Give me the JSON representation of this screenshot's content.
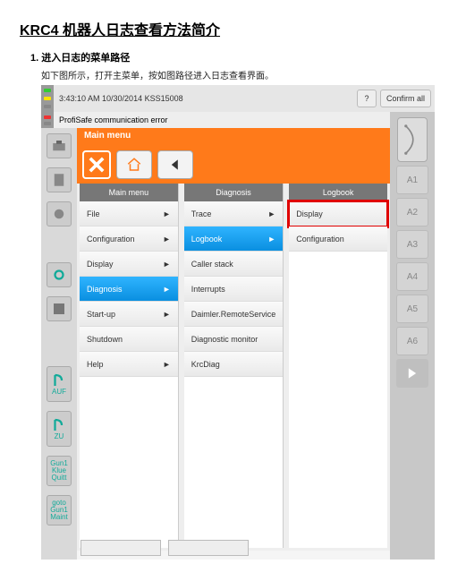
{
  "doc": {
    "title": "KRC4 机器人日志查看方法简介",
    "step_label": "1.  进入日志的菜单路径",
    "step_desc": "如下图所示，打开主菜单，按如图路径进入日志查看界面。"
  },
  "status": {
    "time_line": "3:43:10 AM 10/30/2014 KSS15008",
    "error": "ProfiSafe communication error",
    "help_label": "?",
    "confirm_label": "Confirm all"
  },
  "left_rail": {
    "auf": "AUF",
    "zu": "ZU",
    "gun1quit": "Gun1\nKlue\nQuitt",
    "goto": "goto\nGun1\nMaint"
  },
  "right_rail": {
    "axes": [
      "A1",
      "A2",
      "A3",
      "A4",
      "A5",
      "A6"
    ]
  },
  "menu": {
    "title": "Main menu",
    "col_headers": [
      "Main menu",
      "Diagnosis",
      "Logbook"
    ],
    "main": [
      {
        "label": "File",
        "arrow": true
      },
      {
        "label": "Configuration",
        "arrow": true
      },
      {
        "label": "Display",
        "arrow": true
      },
      {
        "label": "Diagnosis",
        "arrow": true,
        "selected": true
      },
      {
        "label": "Start-up",
        "arrow": true
      },
      {
        "label": "Shutdown",
        "arrow": false
      },
      {
        "label": "Help",
        "arrow": true
      }
    ],
    "diagnosis": [
      {
        "label": "Trace",
        "arrow": true
      },
      {
        "label": "Logbook",
        "arrow": true,
        "selected": true
      },
      {
        "label": "Caller stack",
        "arrow": false
      },
      {
        "label": "Interrupts",
        "arrow": false
      },
      {
        "label": "Daimler.RemoteService",
        "arrow": false
      },
      {
        "label": "Diagnostic monitor",
        "arrow": false
      },
      {
        "label": "KrcDiag",
        "arrow": false
      }
    ],
    "logbook": [
      {
        "label": "Display",
        "arrow": false,
        "highlight": true
      },
      {
        "label": "Configuration",
        "arrow": false
      }
    ]
  }
}
